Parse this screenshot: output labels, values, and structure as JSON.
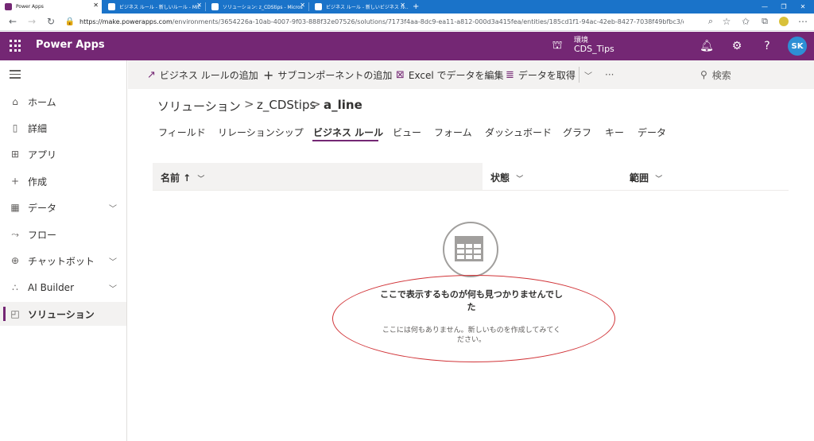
{
  "browser": {
    "tabs": [
      {
        "label": "Power Apps",
        "active": true
      },
      {
        "label": "ビジネス ルール - 新しいルール - Mic"
      },
      {
        "label": "ソリューション: z_CDStips - Micros"
      },
      {
        "label": "ビジネス ルール - 新しいビジネス ル…"
      }
    ],
    "new_tab": "+",
    "url_host": "https://make.powerapps.com",
    "url_path": "/environments/3654226a-10ab-4007-9f03-888f32e07526/solutions/7173f4aa-8dc9-ea11-a812-000d3a415fea/entities/185cd1f1-94ac-42eb-8427-7038f49bfbc3/crcce_z_detail_t..."
  },
  "header": {
    "app_title": "Power Apps",
    "env_label": "環境",
    "env_name": "CDS_Tips",
    "avatar_initials": "SK",
    "brand_color": "#742774"
  },
  "sidebar": {
    "items": [
      {
        "label": "ホーム",
        "icon": "home-icon"
      },
      {
        "label": "詳細",
        "icon": "book-icon"
      },
      {
        "label": "アプリ",
        "icon": "apps-icon"
      },
      {
        "label": "作成",
        "icon": "plus-icon"
      },
      {
        "label": "データ",
        "icon": "table-icon",
        "expandable": true
      },
      {
        "label": "フロー",
        "icon": "flow-icon"
      },
      {
        "label": "チャットボット",
        "icon": "chatbot-icon",
        "expandable": true
      },
      {
        "label": "AI Builder",
        "icon": "ai-icon",
        "expandable": true
      },
      {
        "label": "ソリューション",
        "icon": "solution-icon",
        "active": true
      }
    ]
  },
  "commandbar": {
    "add_rule": "ビジネス ルールの追加",
    "add_subcomponent": "サブコンポーネントの追加",
    "excel_edit": "Excel でデータを編集",
    "get_data": "データを取得",
    "more": "···",
    "search": "検索"
  },
  "breadcrumb": {
    "root": "ソリューション",
    "solution": "z_CDStips",
    "entity": "a_line",
    "separator": ">"
  },
  "tabs": [
    {
      "label": "フィールド"
    },
    {
      "label": "リレーションシップ"
    },
    {
      "label": "ビジネス ルール",
      "active": true
    },
    {
      "label": "ビュー"
    },
    {
      "label": "フォーム"
    },
    {
      "label": "ダッシュボード"
    },
    {
      "label": "グラフ"
    },
    {
      "label": "キー"
    },
    {
      "label": "データ"
    }
  ],
  "grid": {
    "col_name": "名前 ↑",
    "col_status": "状態",
    "col_scope": "範囲"
  },
  "empty_state": {
    "title_line1": "ここで表示するものが何も見つかりませんでし",
    "title_line2": "た",
    "subtitle_line1": "ここには何もありません。新しいものを作成してみてく",
    "subtitle_line2": "ださい。"
  }
}
